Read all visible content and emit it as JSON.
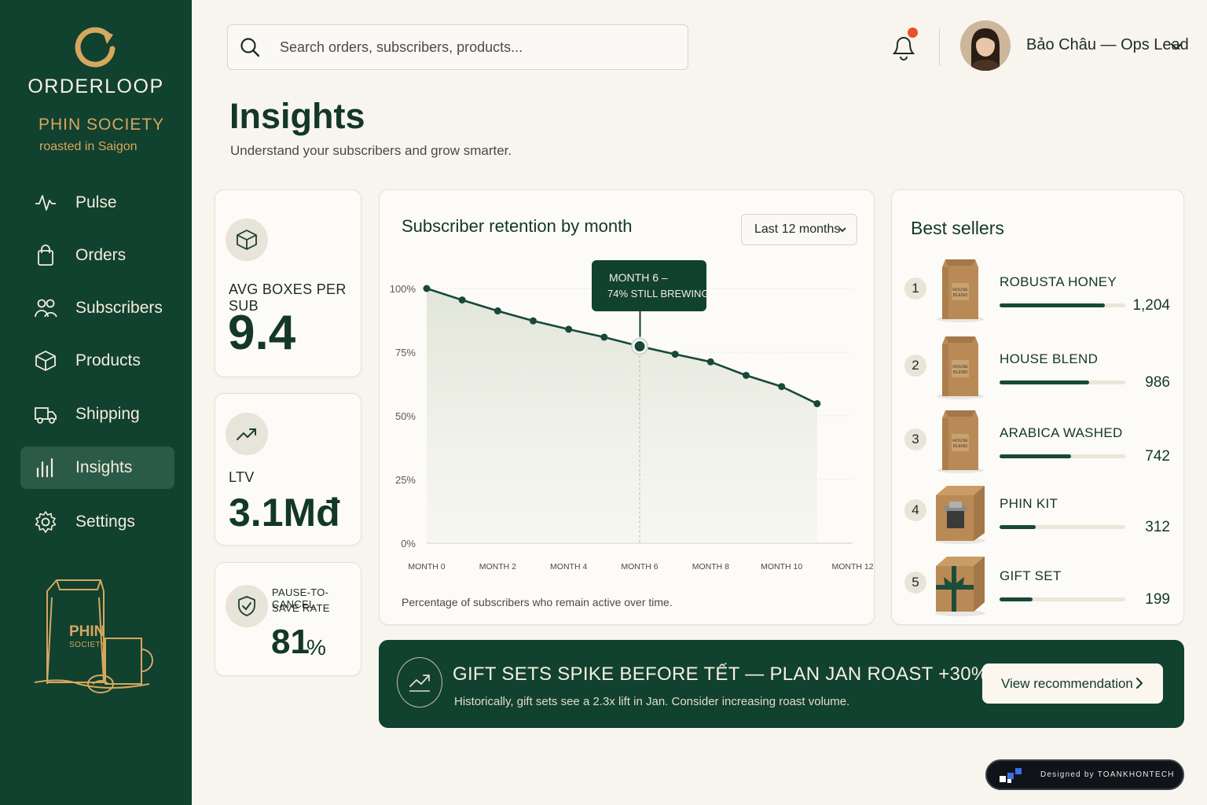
{
  "brand": {
    "name": "ORDERLOOP",
    "store": "PHIN SOCIETY",
    "tagline": "roasted in Saigon",
    "illustration_text": "PHIN",
    "illustration_subtext": "SOCIETY",
    "accent_color": "#d6a75e",
    "sidebar_color": "#11412f"
  },
  "nav": {
    "items": [
      {
        "label": "Pulse",
        "icon": "pulse-icon"
      },
      {
        "label": "Orders",
        "icon": "bag-icon"
      },
      {
        "label": "Subscribers",
        "icon": "users-icon"
      },
      {
        "label": "Products",
        "icon": "box-icon"
      },
      {
        "label": "Shipping",
        "icon": "truck-icon"
      },
      {
        "label": "Insights",
        "icon": "bar-chart-icon",
        "active": true
      },
      {
        "label": "Settings",
        "icon": "gear-icon"
      }
    ]
  },
  "header": {
    "search_placeholder": "Search orders, subscribers, products...",
    "user_name": "Bảo Châu — Ops Lead",
    "notification_dot_color": "#e8532a"
  },
  "page": {
    "title": "Insights",
    "subtitle": "Understand your subscribers and grow smarter."
  },
  "stats": {
    "boxes": {
      "label": "AVG BOXES PER SUB",
      "value": "9.4",
      "icon": "box-icon"
    },
    "ltv": {
      "label": "LTV",
      "value": "3.1Mđ",
      "icon": "trend-up-icon"
    },
    "save": {
      "label_line1": "PAUSE-TO-CANCEL",
      "label_line2": "SAVE RATE",
      "value": "81",
      "unit": "%",
      "icon": "shield-check-icon"
    }
  },
  "retention": {
    "title": "Subscriber retention by month",
    "range": "Last 12 months",
    "note": "Percentage of subscribers who remain active over time.",
    "tooltip_line1": "MONTH 6 –",
    "tooltip_line2": "74% STILL BREWING"
  },
  "chart_data": {
    "type": "area",
    "title": "Subscriber retention by month",
    "xlabel": "",
    "ylabel": "",
    "x": [
      0,
      1,
      2,
      3,
      4,
      5,
      6,
      7,
      8,
      9,
      10,
      11
    ],
    "y": [
      100,
      95.5,
      91.2,
      87.3,
      84.0,
      80.9,
      77.3,
      74.2,
      71.2,
      65.9,
      61.5,
      54.8
    ],
    "highlight_index": 6,
    "x_tick_values": [
      0,
      2,
      4,
      6,
      8,
      10,
      12
    ],
    "x_tick_labels": [
      "MONTH 0",
      "MONTH 2",
      "MONTH 4",
      "MONTH 6",
      "MONTH 8",
      "MONTH 10",
      "MONTH 12"
    ],
    "y_tick_values": [
      100,
      75,
      50,
      25,
      0
    ],
    "y_tick_labels": [
      "100%",
      "75%",
      "50%",
      "25%",
      "0%"
    ],
    "ylim": [
      0,
      100
    ],
    "grid": true,
    "line_color": "#17493a"
  },
  "best_sellers": {
    "title": "Best sellers",
    "items": [
      {
        "rank": "1",
        "name": "ROBUSTA HONEY",
        "value": "1,204",
        "share": 0.84,
        "image": "coffee-bag"
      },
      {
        "rank": "2",
        "name": "HOUSE BLEND",
        "value": "986",
        "share": 0.71,
        "image": "coffee-bag"
      },
      {
        "rank": "3",
        "name": "ARABICA WASHED",
        "value": "742",
        "share": 0.57,
        "image": "coffee-bag"
      },
      {
        "rank": "4",
        "name": "PHIN KIT",
        "value": "312",
        "share": 0.29,
        "image": "phin-kit-box"
      },
      {
        "rank": "5",
        "name": "GIFT SET",
        "value": "199",
        "share": 0.26,
        "image": "gift-box"
      }
    ],
    "bag_label_line1": "HOUSE",
    "bag_label_line2": "BLEND"
  },
  "banner": {
    "title": "GIFT SETS SPIKE BEFORE TẾT — PLAN JAN ROAST +30%",
    "text": "Historically, gift sets see a 2.3x lift in Jan. Consider increasing roast volume.",
    "button_label": "View recommendation"
  },
  "credit": {
    "text": "Designed by TOANKHONTECH"
  }
}
